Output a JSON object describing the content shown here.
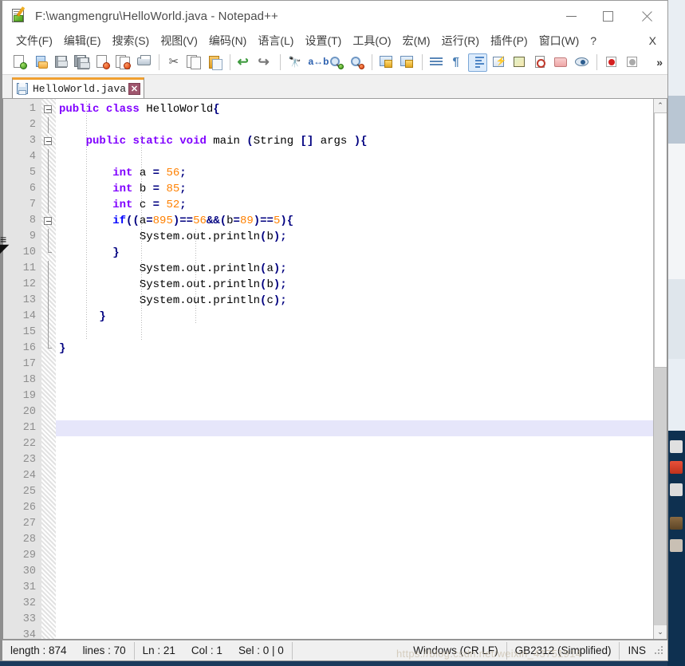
{
  "window": {
    "title": "F:\\wangmengru\\HelloWorld.java - Notepad++",
    "icon": "notepad-plus-plus-document-icon",
    "controls": {
      "minimize": "–",
      "maximize": "□",
      "close": "✕"
    }
  },
  "menubar": {
    "items": [
      {
        "label": "文件(F)",
        "name": "file"
      },
      {
        "label": "编辑(E)",
        "name": "edit"
      },
      {
        "label": "搜索(S)",
        "name": "search"
      },
      {
        "label": "视图(V)",
        "name": "view"
      },
      {
        "label": "编码(N)",
        "name": "encoding"
      },
      {
        "label": "语言(L)",
        "name": "language"
      },
      {
        "label": "设置(T)",
        "name": "settings"
      },
      {
        "label": "工具(O)",
        "name": "tools"
      },
      {
        "label": "宏(M)",
        "name": "macro"
      },
      {
        "label": "运行(R)",
        "name": "run"
      },
      {
        "label": "插件(P)",
        "name": "plugins"
      },
      {
        "label": "窗口(W)",
        "name": "window"
      },
      {
        "label": "?",
        "name": "help"
      }
    ],
    "close_doc_label": "X"
  },
  "toolbar": {
    "overflow_label": "»",
    "buttons": [
      {
        "name": "new-file-icon",
        "tip": "新建"
      },
      {
        "name": "open-file-icon",
        "tip": "打开"
      },
      {
        "name": "save-icon",
        "tip": "保存"
      },
      {
        "name": "save-all-icon",
        "tip": "保存所有"
      },
      {
        "name": "close-file-icon",
        "tip": "关闭"
      },
      {
        "name": "close-all-files-icon",
        "tip": "关闭所有"
      },
      {
        "name": "print-icon",
        "tip": "打印"
      },
      {
        "name": "cut-icon",
        "tip": "剪切"
      },
      {
        "name": "copy-icon",
        "tip": "复制"
      },
      {
        "name": "paste-icon",
        "tip": "粘贴"
      },
      {
        "name": "undo-icon",
        "tip": "撤销"
      },
      {
        "name": "redo-icon",
        "tip": "重做"
      },
      {
        "name": "find-icon",
        "tip": "查找"
      },
      {
        "name": "replace-icon",
        "tip": "替换"
      },
      {
        "name": "zoom-in-icon",
        "tip": "放大"
      },
      {
        "name": "zoom-out-icon",
        "tip": "缩小"
      },
      {
        "name": "sync-vertical-scroll-icon",
        "tip": "同步垂直滚动"
      },
      {
        "name": "sync-horizontal-scroll-icon",
        "tip": "同步水平滚动"
      },
      {
        "name": "word-wrap-icon",
        "tip": "自动换行"
      },
      {
        "name": "show-all-characters-icon",
        "tip": "显示所有字符"
      },
      {
        "name": "indent-guideline-icon",
        "tip": "显示缩进参考线"
      },
      {
        "name": "user-defined-language-icon",
        "tip": "用户自定义语言"
      },
      {
        "name": "document-map-icon",
        "tip": "文档地图"
      },
      {
        "name": "function-list-icon",
        "tip": "函数列表"
      },
      {
        "name": "folder-as-workspace-icon",
        "tip": "文件夹作为工作区"
      },
      {
        "name": "monitoring-icon",
        "tip": "监视文件"
      },
      {
        "name": "record-macro-icon",
        "tip": "开始录制宏"
      },
      {
        "name": "stop-macro-icon",
        "tip": "停止录制宏"
      }
    ]
  },
  "tabs": [
    {
      "label": "HelloWorld.java",
      "close": "✕",
      "active": true,
      "icon": "saved-document-icon"
    }
  ],
  "editor": {
    "current_line": 21,
    "total_visible_lines": 34,
    "line_numbers": [
      1,
      2,
      3,
      4,
      5,
      6,
      7,
      8,
      9,
      10,
      11,
      12,
      13,
      14,
      15,
      16,
      17,
      18,
      19,
      20,
      21,
      22,
      23,
      24,
      25,
      26,
      27,
      28,
      29,
      30,
      31,
      32,
      33,
      34
    ],
    "lines": [
      {
        "n": 1,
        "fold": "open",
        "tokens": [
          {
            "t": "public",
            "c": "kw"
          },
          {
            "t": " ",
            "c": "pl"
          },
          {
            "t": "class",
            "c": "kw"
          },
          {
            "t": " ",
            "c": "pl"
          },
          {
            "t": "HelloWorld",
            "c": "cls"
          },
          {
            "t": "{",
            "c": "op"
          }
        ]
      },
      {
        "n": 2,
        "fold": "line",
        "tokens": []
      },
      {
        "n": 3,
        "fold": "open2",
        "tokens": [
          {
            "t": "    ",
            "c": "pl"
          },
          {
            "t": "public",
            "c": "kw"
          },
          {
            "t": " ",
            "c": "pl"
          },
          {
            "t": "static",
            "c": "kw"
          },
          {
            "t": " ",
            "c": "pl"
          },
          {
            "t": "void",
            "c": "kw"
          },
          {
            "t": " main ",
            "c": "pl"
          },
          {
            "t": "(",
            "c": "op"
          },
          {
            "t": "String ",
            "c": "pl"
          },
          {
            "t": "[]",
            "c": "op"
          },
          {
            "t": " args ",
            "c": "pl"
          },
          {
            "t": ")",
            "c": "op"
          },
          {
            "t": "{",
            "c": "op"
          }
        ]
      },
      {
        "n": 4,
        "fold": "line",
        "tokens": []
      },
      {
        "n": 5,
        "fold": "line",
        "tokens": [
          {
            "t": "        ",
            "c": "pl"
          },
          {
            "t": "int",
            "c": "kw"
          },
          {
            "t": " a ",
            "c": "pl"
          },
          {
            "t": "=",
            "c": "op"
          },
          {
            "t": " ",
            "c": "pl"
          },
          {
            "t": "56",
            "c": "num"
          },
          {
            "t": ";",
            "c": "op"
          }
        ]
      },
      {
        "n": 6,
        "fold": "line",
        "tokens": [
          {
            "t": "        ",
            "c": "pl"
          },
          {
            "t": "int",
            "c": "kw"
          },
          {
            "t": " b ",
            "c": "pl"
          },
          {
            "t": "=",
            "c": "op"
          },
          {
            "t": " ",
            "c": "pl"
          },
          {
            "t": "85",
            "c": "num"
          },
          {
            "t": ";",
            "c": "op"
          }
        ]
      },
      {
        "n": 7,
        "fold": "line",
        "tokens": [
          {
            "t": "        ",
            "c": "pl"
          },
          {
            "t": "int",
            "c": "kw"
          },
          {
            "t": " c ",
            "c": "pl"
          },
          {
            "t": "=",
            "c": "op"
          },
          {
            "t": " ",
            "c": "pl"
          },
          {
            "t": "52",
            "c": "num"
          },
          {
            "t": ";",
            "c": "op"
          }
        ]
      },
      {
        "n": 8,
        "fold": "open3",
        "tokens": [
          {
            "t": "        ",
            "c": "pl"
          },
          {
            "t": "if",
            "c": "kw2"
          },
          {
            "t": "((",
            "c": "op"
          },
          {
            "t": "a",
            "c": "pl"
          },
          {
            "t": "=",
            "c": "op"
          },
          {
            "t": "895",
            "c": "num"
          },
          {
            "t": ")",
            "c": "op"
          },
          {
            "t": "==",
            "c": "op"
          },
          {
            "t": "56",
            "c": "num"
          },
          {
            "t": "&&",
            "c": "op"
          },
          {
            "t": "(",
            "c": "op"
          },
          {
            "t": "b",
            "c": "pl"
          },
          {
            "t": "=",
            "c": "op"
          },
          {
            "t": "89",
            "c": "num"
          },
          {
            "t": ")",
            "c": "op"
          },
          {
            "t": "==",
            "c": "op"
          },
          {
            "t": "5",
            "c": "num"
          },
          {
            "t": ")",
            "c": "op"
          },
          {
            "t": "{",
            "c": "op"
          }
        ]
      },
      {
        "n": 9,
        "fold": "line3",
        "tokens": [
          {
            "t": "            System.out.println",
            "c": "pl"
          },
          {
            "t": "(",
            "c": "op"
          },
          {
            "t": "b",
            "c": "pl"
          },
          {
            "t": ")",
            "c": "op"
          },
          {
            "t": ";",
            "c": "op"
          }
        ]
      },
      {
        "n": 10,
        "fold": "end3",
        "tokens": [
          {
            "t": "        ",
            "c": "pl"
          },
          {
            "t": "}",
            "c": "op"
          }
        ]
      },
      {
        "n": 11,
        "fold": "line",
        "tokens": [
          {
            "t": "            System.out.println",
            "c": "pl"
          },
          {
            "t": "(",
            "c": "op"
          },
          {
            "t": "a",
            "c": "pl"
          },
          {
            "t": ")",
            "c": "op"
          },
          {
            "t": ";",
            "c": "op"
          }
        ]
      },
      {
        "n": 12,
        "fold": "line",
        "tokens": [
          {
            "t": "            System.out.println",
            "c": "pl"
          },
          {
            "t": "(",
            "c": "op"
          },
          {
            "t": "b",
            "c": "pl"
          },
          {
            "t": ")",
            "c": "op"
          },
          {
            "t": ";",
            "c": "op"
          }
        ]
      },
      {
        "n": 13,
        "fold": "line",
        "tokens": [
          {
            "t": "            System.out.println",
            "c": "pl"
          },
          {
            "t": "(",
            "c": "op"
          },
          {
            "t": "c",
            "c": "pl"
          },
          {
            "t": ")",
            "c": "op"
          },
          {
            "t": ";",
            "c": "op"
          }
        ]
      },
      {
        "n": 14,
        "fold": "line",
        "tokens": [
          {
            "t": "      ",
            "c": "pl"
          },
          {
            "t": "}",
            "c": "op"
          }
        ]
      },
      {
        "n": 15,
        "fold": "line",
        "tokens": []
      },
      {
        "n": 16,
        "fold": "end1",
        "tokens": [
          {
            "t": "",
            "c": "pl"
          },
          {
            "t": "}",
            "c": "op"
          }
        ]
      },
      {
        "n": 17,
        "fold": "none",
        "tokens": []
      },
      {
        "n": 18,
        "fold": "none",
        "tokens": []
      },
      {
        "n": 19,
        "fold": "none",
        "tokens": []
      },
      {
        "n": 20,
        "fold": "none",
        "tokens": []
      },
      {
        "n": 21,
        "fold": "none",
        "tokens": []
      },
      {
        "n": 22,
        "fold": "none",
        "tokens": []
      },
      {
        "n": 23,
        "fold": "none",
        "tokens": []
      },
      {
        "n": 24,
        "fold": "none",
        "tokens": []
      },
      {
        "n": 25,
        "fold": "none",
        "tokens": []
      },
      {
        "n": 26,
        "fold": "none",
        "tokens": []
      },
      {
        "n": 27,
        "fold": "none",
        "tokens": []
      },
      {
        "n": 28,
        "fold": "none",
        "tokens": []
      },
      {
        "n": 29,
        "fold": "none",
        "tokens": []
      },
      {
        "n": 30,
        "fold": "none",
        "tokens": []
      },
      {
        "n": 31,
        "fold": "none",
        "tokens": []
      },
      {
        "n": 32,
        "fold": "none",
        "tokens": []
      },
      {
        "n": 33,
        "fold": "none",
        "tokens": []
      },
      {
        "n": 34,
        "fold": "none",
        "tokens": []
      }
    ]
  },
  "scrollbar": {
    "up_arrow": "⌃",
    "down_arrow": "⌄"
  },
  "statusbar": {
    "length_label": "length : 874",
    "lines_label": "lines : 70",
    "ln_label": "Ln : 21",
    "col_label": "Col : 1",
    "sel_label": "Sel : 0 | 0",
    "eol_label": "Windows (CR LF)",
    "encoding_label": "GB2312 (Simplified)",
    "insert_mode_label": "INS"
  },
  "watermark": "https://blog.csdn.net/weixin_43751914",
  "colors": {
    "tab_accent": "#f0a030",
    "current_line": "#e6e6fa",
    "keyword": "#8000ff",
    "keyword2": "#0000ff",
    "number": "#ff8000",
    "operator": "#000080",
    "gutter_bg": "#e4e4e4",
    "desktop": "#0e3050"
  }
}
